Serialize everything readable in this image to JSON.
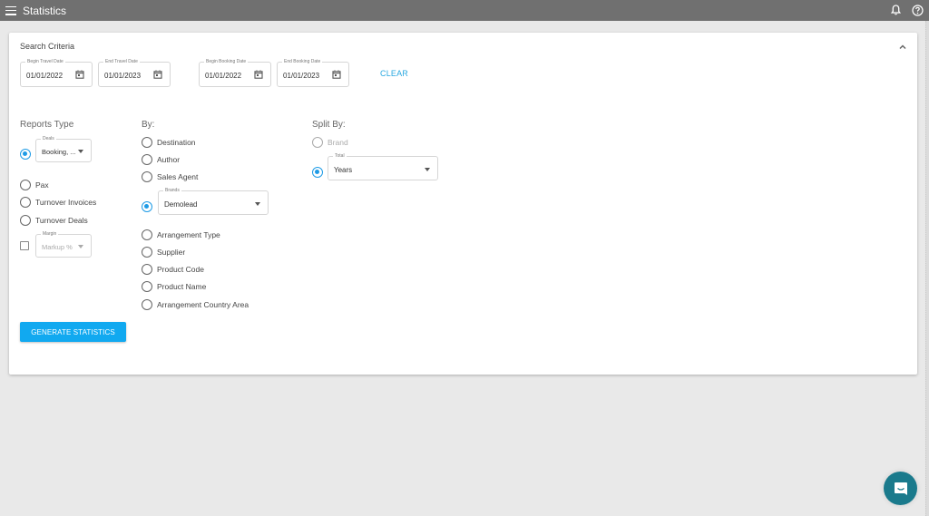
{
  "appbar": {
    "title": "Statistics",
    "icons": [
      "menu-icon",
      "bell-icon",
      "help-icon"
    ]
  },
  "search_criteria": {
    "title": "Search Criteria",
    "date_fields": [
      {
        "label": "Begin Travel Date",
        "value": "01/01/2022"
      },
      {
        "label": "End Travel Date",
        "value": "01/01/2023"
      },
      {
        "label": "Begin Booking Date",
        "value": "01/01/2022"
      },
      {
        "label": "End Booking Date",
        "value": "01/01/2023"
      }
    ],
    "clear_label": "CLEAR"
  },
  "reports_type": {
    "title": "Reports Type",
    "deals_select": {
      "label": "Deals",
      "value": "Booking, ..."
    },
    "options": [
      {
        "label": "Pax",
        "checked": false
      },
      {
        "label": "Turnover Invoices",
        "checked": false
      },
      {
        "label": "Turnover Deals",
        "checked": false
      }
    ],
    "margin_select": {
      "label": "Margin",
      "value": "Markup %",
      "disabled": true
    }
  },
  "by": {
    "title": "By:",
    "options_before": [
      {
        "label": "Destination",
        "checked": false
      },
      {
        "label": "Author",
        "checked": false
      },
      {
        "label": "Sales Agent",
        "checked": false
      }
    ],
    "brands_select": {
      "label": "Brands",
      "value": "Demolead",
      "checked": true
    },
    "options_after": [
      {
        "label": "Arrangement Type",
        "checked": false
      },
      {
        "label": "Supplier",
        "checked": false
      },
      {
        "label": "Product Code",
        "checked": false
      },
      {
        "label": "Product Name",
        "checked": false
      },
      {
        "label": "Arrangement Country Area",
        "checked": false
      }
    ]
  },
  "split_by": {
    "title": "Split By:",
    "brand_option": {
      "label": "Brand",
      "disabled": true
    },
    "total_select": {
      "label": "Total",
      "value": "Years",
      "checked": true
    }
  },
  "generate_label": "GENERATE STATISTICS",
  "colors": {
    "appbar": "#707070",
    "accent": "#1e9be6",
    "button": "#11a9f0",
    "chat_fab": "#1a7a8c"
  }
}
